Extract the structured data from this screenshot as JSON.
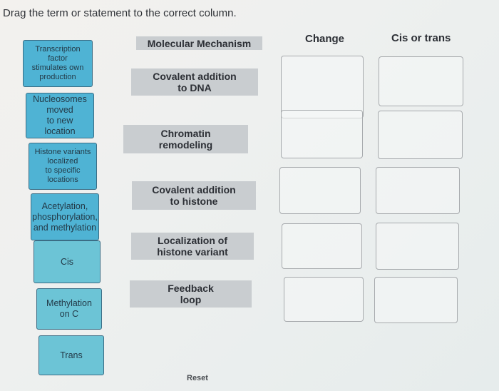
{
  "instruction": "Drag the term or statement to the correct column.",
  "terms": [
    {
      "label": "Transcription\nfactor\nstimulates own\nproduction"
    },
    {
      "label": "Nucleosomes\nmoved\nto new\nlocation"
    },
    {
      "label": "Histone variants\nlocalized\nto specific\nlocations"
    },
    {
      "label": "Acetylation,\nphosphorylation,\nand methylation"
    },
    {
      "label": "Cis"
    },
    {
      "label": "Methylation\non C"
    },
    {
      "label": "Trans"
    }
  ],
  "columns": {
    "mechanism_header": "Molecular Mechanism",
    "change_header": "Change",
    "cis_trans_header": "Cis or trans"
  },
  "mechanisms": [
    {
      "label": "Covalent addition\nto DNA"
    },
    {
      "label": "Chromatin\nremodeling"
    },
    {
      "label": "Covalent addition\nto histone"
    },
    {
      "label": "Localization of\nhistone variant"
    },
    {
      "label": "Feedback\nloop"
    }
  ],
  "reset_label": "Reset",
  "colors": {
    "term_tile": "#4fb3d4",
    "term_tile_light": "#6cc4d6",
    "mechanism_bg": "#c9cdd0",
    "drop_border": "#a7aaad"
  }
}
